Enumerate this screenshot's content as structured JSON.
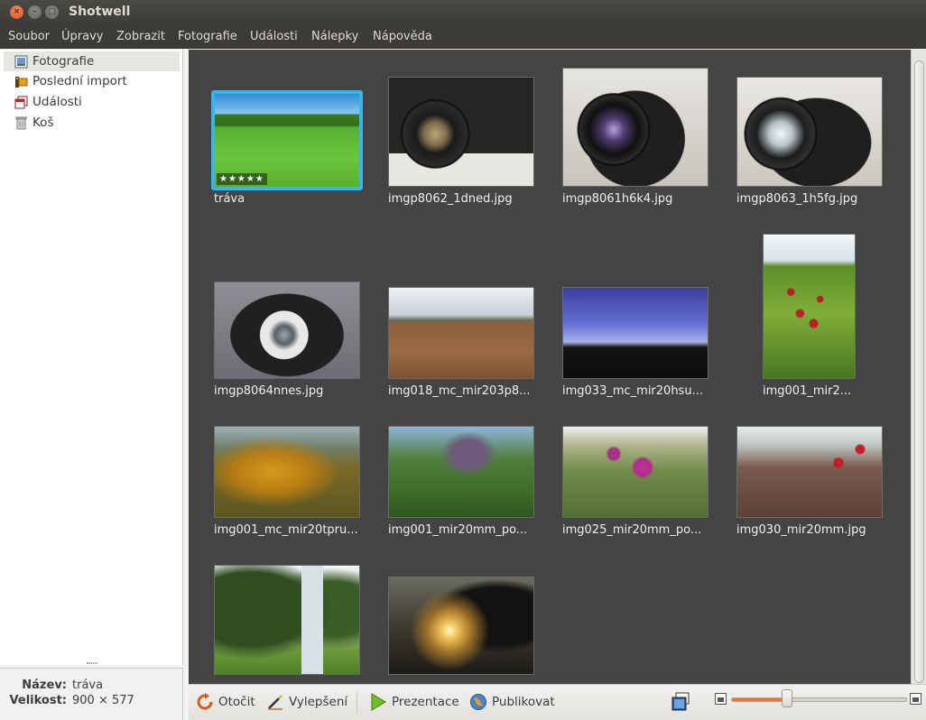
{
  "window": {
    "title": "Shotwell",
    "close_glyph": "×",
    "min_glyph": "–",
    "max_glyph": "□"
  },
  "menu": [
    "Soubor",
    "Úpravy",
    "Zobrazit",
    "Fotografie",
    "Události",
    "Nálepky",
    "Nápověda"
  ],
  "sidebar": {
    "items": [
      {
        "label": "Fotografie",
        "icon": "photos-icon",
        "selected": true
      },
      {
        "label": "Poslední import",
        "icon": "film-roll-icon",
        "selected": false
      },
      {
        "label": "Události",
        "icon": "events-icon",
        "selected": false
      },
      {
        "label": "Koš",
        "icon": "trash-icon",
        "selected": false
      }
    ]
  },
  "info": {
    "name_label": "Název:",
    "name_value": "tráva",
    "size_label": "Velikost:",
    "size_value": "900 × 577"
  },
  "photos": [
    {
      "caption": "tráva",
      "selected": true,
      "rating": 5,
      "stars": "★★★★★"
    },
    {
      "caption": "imgp8062_1dned.jpg"
    },
    {
      "caption": "imgp8061h6k4.jpg"
    },
    {
      "caption": "imgp8063_1h5fg.jpg"
    },
    {
      "caption": "imgp8064nnes.jpg"
    },
    {
      "caption": "img018_mc_mir203p8..."
    },
    {
      "caption": "img033_mc_mir20hsu..."
    },
    {
      "caption": "img001_mir2..."
    },
    {
      "caption": "img001_mc_mir20tpru..."
    },
    {
      "caption": "img001_mir20mm_po..."
    },
    {
      "caption": "img025_mir20mm_po..."
    },
    {
      "caption": "img030_mir20mm.jpg"
    },
    {
      "caption": ""
    },
    {
      "caption": ""
    }
  ],
  "toolbar": {
    "rotate_label": "Otočit",
    "enhance_label": "Vylepšení",
    "slideshow_label": "Prezentace",
    "publish_label": "Publikovat",
    "zoom_level": 0.32
  },
  "colors": {
    "selection": "#3db4e7",
    "viewer_bg": "#444444",
    "slider_fill": "#e8743b"
  }
}
